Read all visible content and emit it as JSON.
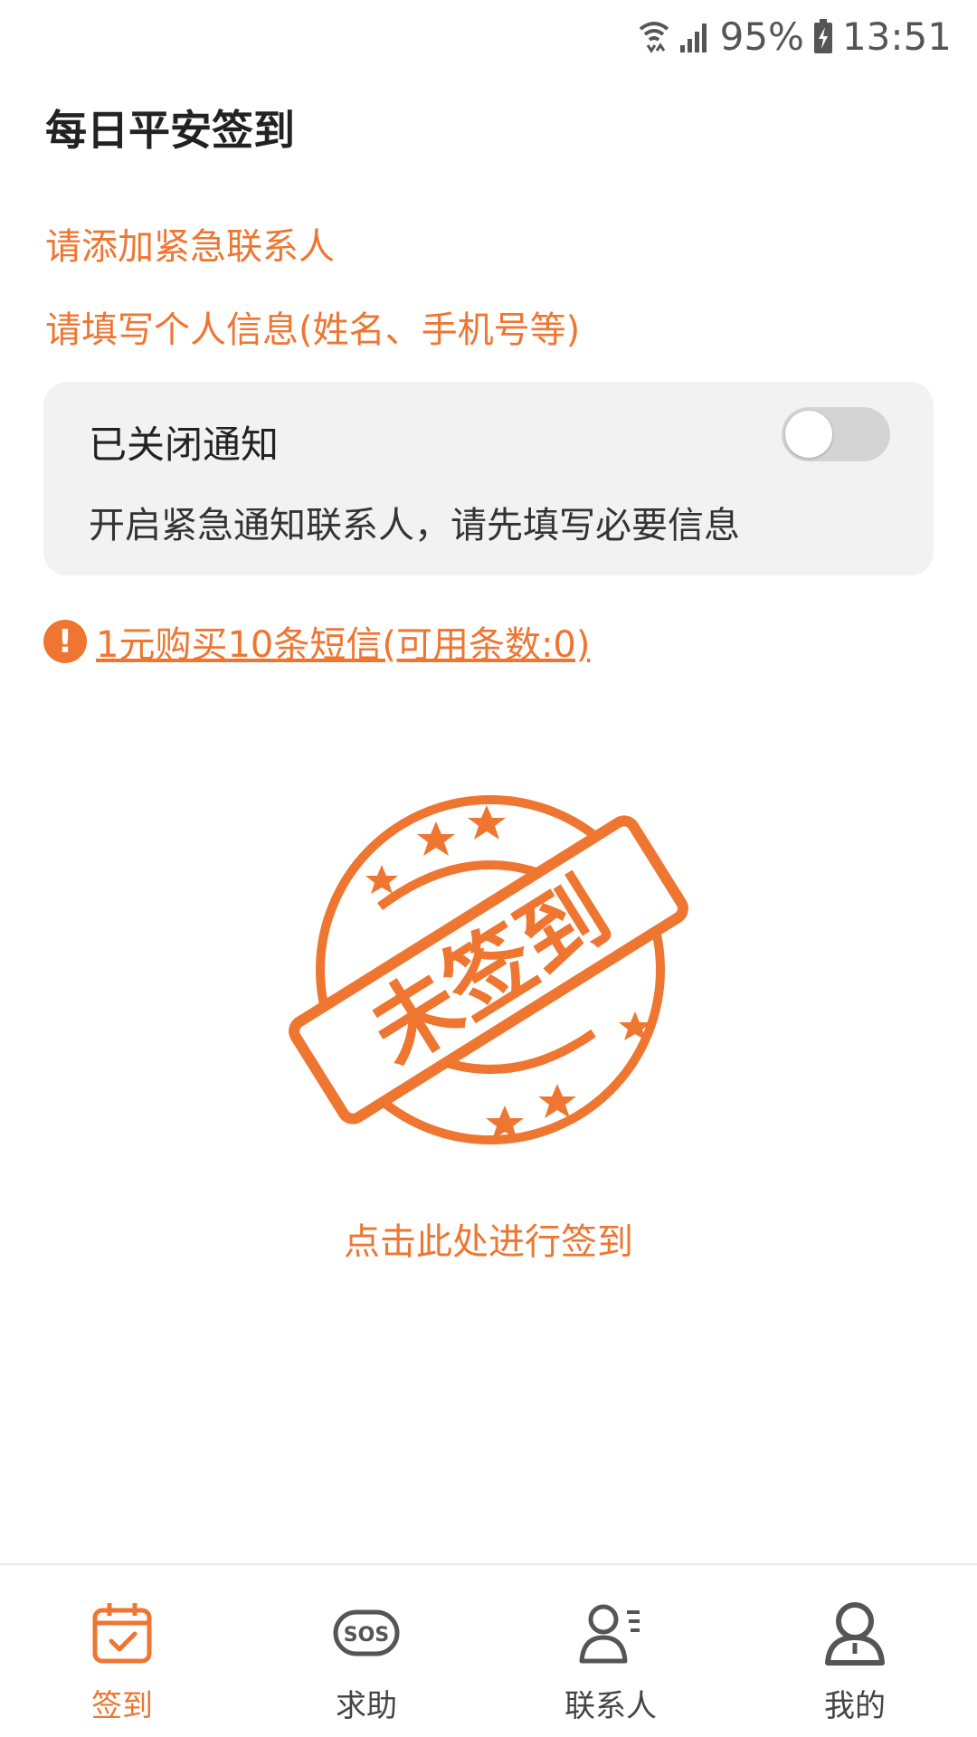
{
  "status_bar": {
    "battery": "95%",
    "time": "13:51"
  },
  "page": {
    "title": "每日平安签到"
  },
  "warnings": {
    "add_contact": "请添加紧急联系人",
    "fill_info": "请填写个人信息(姓名、手机号等)"
  },
  "notify_card": {
    "title": "已关闭通知",
    "description": "开启紧急通知联系人，请先填写必要信息",
    "toggle_on": false
  },
  "sms": {
    "link_text": "1元购买10条短信(可用条数:0)"
  },
  "stamp": {
    "text": "未签到"
  },
  "checkin": {
    "hint": "点击此处进行签到"
  },
  "tabbar": {
    "tabs": [
      {
        "label": "签到",
        "icon": "calendar-check-icon",
        "active": true
      },
      {
        "label": "求助",
        "icon": "sos-icon",
        "active": false
      },
      {
        "label": "联系人",
        "icon": "contact-list-icon",
        "active": false
      },
      {
        "label": "我的",
        "icon": "profile-icon",
        "active": false
      }
    ]
  },
  "colors": {
    "accent": "#ee7631",
    "card_bg": "#f2f2f2",
    "toggle_off": "#d4d4d4"
  }
}
